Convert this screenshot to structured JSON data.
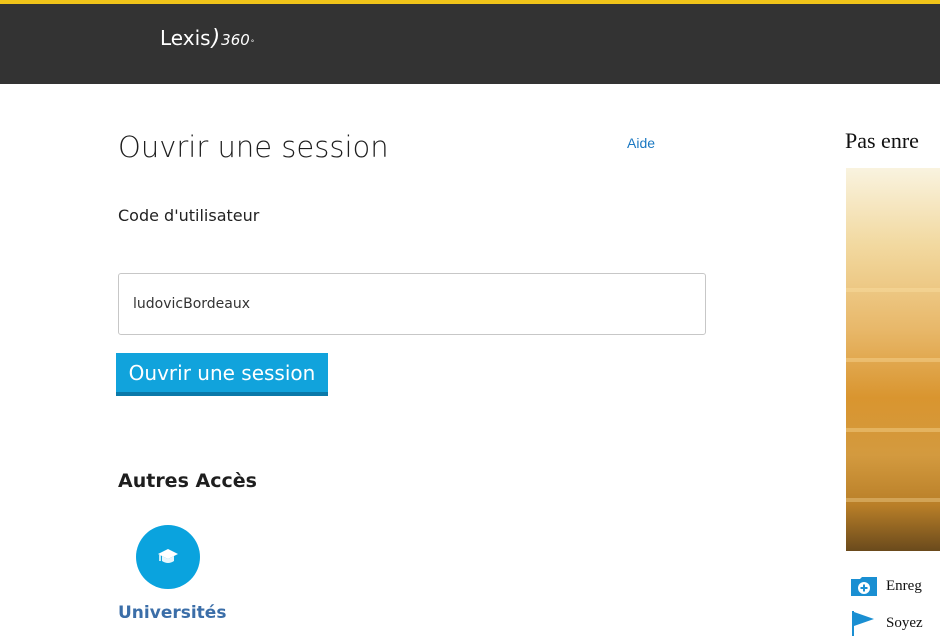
{
  "header": {
    "logo_text": "Lexis",
    "logo_number": "360",
    "logo_reg": "°"
  },
  "login": {
    "title": "Ouvrir une session",
    "help_link": "Aide",
    "user_label": "Code d'utilisateur",
    "user_value": "ludovicBordeaux",
    "submit_label": "Ouvrir une session"
  },
  "other_access": {
    "heading": "Autres Accès",
    "items": [
      {
        "label": "Universités",
        "icon": "graduation-cap-icon"
      }
    ]
  },
  "side_panel": {
    "title": "Pas enre",
    "items": [
      {
        "label": "Enreg",
        "icon": "folder-plus-icon"
      },
      {
        "label": "Soyez",
        "icon": "flag-icon"
      }
    ]
  },
  "colors": {
    "accent": "#11a3dc",
    "topbar": "#333333",
    "topbar_border": "#f0c419",
    "link": "#1b78c2"
  }
}
